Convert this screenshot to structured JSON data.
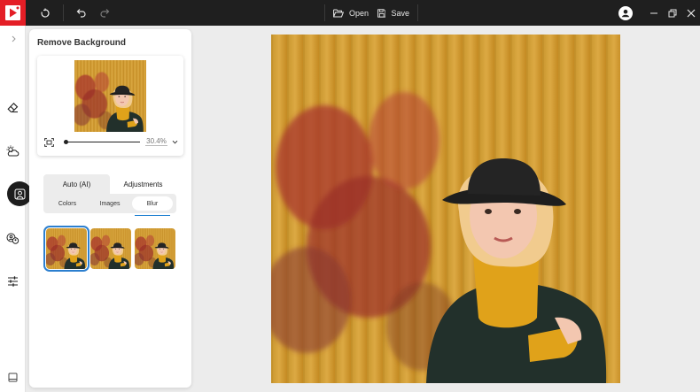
{
  "toolbar": {
    "open_label": "Open",
    "save_label": "Save"
  },
  "panel": {
    "title": "Remove Background",
    "zoom_value": "30.4%",
    "tabs": [
      {
        "label": "Auto (AI)",
        "active": true
      },
      {
        "label": "Adjustments",
        "active": false
      }
    ],
    "subtabs": [
      {
        "label": "Colors",
        "active": false
      },
      {
        "label": "Images",
        "active": false
      },
      {
        "label": "Blur",
        "active": true
      }
    ],
    "zoom_level": 0.03
  },
  "colors": {
    "accent": "#2c7fcf",
    "brand": "#e41e26",
    "titlebar": "#1f1f1f"
  }
}
